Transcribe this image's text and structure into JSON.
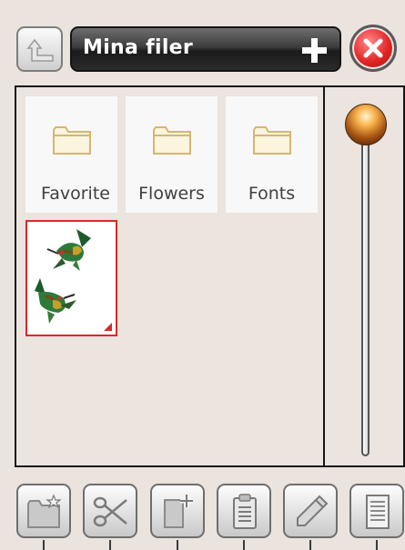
{
  "header": {
    "title": "Mina filer"
  },
  "files": [
    {
      "name": "Favorite",
      "type": "folder"
    },
    {
      "name": "Flowers",
      "type": "folder"
    },
    {
      "name": "Fonts",
      "type": "folder"
    },
    {
      "name": "",
      "type": "embroidery-design",
      "selected": true
    }
  ],
  "scrollbar": {
    "position": 0.0
  },
  "toolbar": {
    "buttons": [
      {
        "icon": "new-folder-icon"
      },
      {
        "icon": "scissors-icon"
      },
      {
        "icon": "new-file-icon"
      },
      {
        "icon": "clipboard-icon"
      },
      {
        "icon": "pencil-icon"
      },
      {
        "icon": "document-icon"
      }
    ]
  },
  "colors": {
    "background": "#eae3de",
    "title_bar": "#2b2b2b",
    "close": "#e12323",
    "selection": "#d82a2a",
    "folder": "#d4b770"
  }
}
